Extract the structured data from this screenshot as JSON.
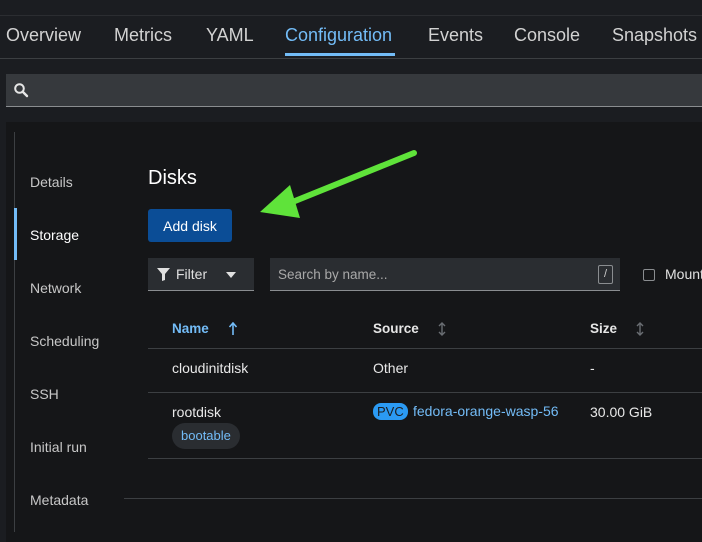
{
  "tabs": [
    {
      "label": "Overview"
    },
    {
      "label": "Metrics"
    },
    {
      "label": "YAML"
    },
    {
      "label": "Configuration"
    },
    {
      "label": "Events"
    },
    {
      "label": "Console"
    },
    {
      "label": "Snapshots"
    }
  ],
  "active_tab": "Configuration",
  "search": {
    "icon": "search-icon",
    "placeholder": ""
  },
  "sidebar": {
    "items": [
      {
        "label": "Details"
      },
      {
        "label": "Storage"
      },
      {
        "label": "Network"
      },
      {
        "label": "Scheduling"
      },
      {
        "label": "SSH"
      },
      {
        "label": "Initial run"
      },
      {
        "label": "Metadata"
      }
    ],
    "active": "Storage"
  },
  "disks": {
    "heading": "Disks",
    "add_label": "Add disk",
    "filter_label": "Filter",
    "search_placeholder": "Search by name...",
    "search_shortcut": "/",
    "mount_label": "Mount",
    "columns": {
      "name": "Name",
      "source": "Source",
      "size": "Size"
    },
    "sort_column": "Name",
    "rows": [
      {
        "name": "cloudinitdisk",
        "source": "Other",
        "size": "-"
      },
      {
        "name": "rootdisk",
        "label": "bootable",
        "source_badge": "PVC",
        "source": "fedora-orange-wasp-56",
        "size": "30.00 GiB"
      }
    ]
  },
  "annotation": {
    "arrow_color": "#5fe33a"
  },
  "colors": {
    "accent": "#73bcf7",
    "primary_button": "#0b4d96",
    "background": "#1b1d21",
    "panel": "#151618"
  }
}
